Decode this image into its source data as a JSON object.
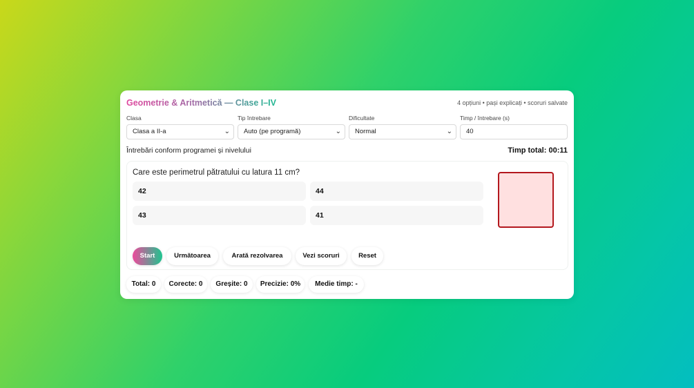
{
  "header": {
    "title": "Geometrie & Aritmetică — Clase I–IV",
    "subtitle": "4 opțiuni • pași explicați • scoruri salvate"
  },
  "controls": {
    "clasa": {
      "label": "Clasa",
      "value": "Clasa a II-a"
    },
    "tip": {
      "label": "Tip întrebare",
      "value": "Auto (pe programă)"
    },
    "dificultate": {
      "label": "Dificultate",
      "value": "Normal"
    },
    "timp": {
      "label": "Timp / întrebare (s)",
      "value": "40"
    }
  },
  "info_text": "Întrebări conform programei și nivelului",
  "timer_text": "Timp total: 00:11",
  "question": {
    "text": "Care este perimetrul pătratului cu latura 11 cm?",
    "options": [
      "42",
      "44",
      "43",
      "41"
    ]
  },
  "buttons": {
    "start": "Start",
    "next": "Următoarea",
    "solution": "Arată rezolvarea",
    "scores": "Vezi scoruri",
    "reset": "Reset"
  },
  "stats": {
    "total": "Total: 0",
    "correct": "Corecte: 0",
    "wrong": "Greșite: 0",
    "precision": "Precizie: 0%",
    "avg_time": "Medie timp: -"
  },
  "colors": {
    "shape_fill": "#ffe0e0",
    "shape_stroke": "#b3171d",
    "accent_pink": "#ec4a9c",
    "accent_green": "#1fc48f"
  },
  "icons": {
    "select_arrow": "chevron-down-icon"
  }
}
